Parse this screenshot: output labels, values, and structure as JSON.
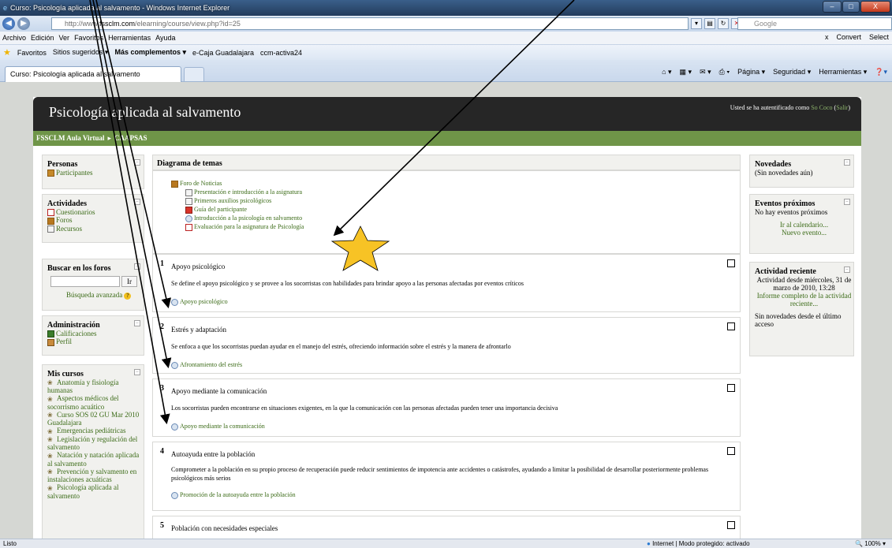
{
  "window": {
    "title": "Curso: Psicología aplicada al salvamento - Windows Internet Explorer",
    "min_label": "–",
    "max_label": "□",
    "close_label": "X"
  },
  "address": {
    "url_prefix": "http://www.",
    "url_domain": "fssclm.com",
    "url_path": "/elearning/course/view.php?id=25",
    "search_placeholder": "Google"
  },
  "menubar": {
    "items": [
      "Archivo",
      "Edición",
      "Ver",
      "Favoritos",
      "Herramientas",
      "Ayuda"
    ],
    "right_close": "x",
    "convert": "Convert",
    "select": "Select"
  },
  "favorites": {
    "label": "Favoritos",
    "items": [
      "Sitios sugeridos ▾",
      "Más complementos ▾",
      "e-Caja Guadalajara",
      "ccm-activa24"
    ]
  },
  "tabs": {
    "active": "Curso: Psicología aplicada al salvamento"
  },
  "commandbar": {
    "items": [
      "Página ▾",
      "Seguridad ▾",
      "Herramientas ▾"
    ]
  },
  "site": {
    "title": "Psicología aplicada al salvamento",
    "login_text": "Usted se ha autentificado como ",
    "user": "So Coco",
    "logout": "Salir"
  },
  "breadcrumb": {
    "home": "FSSCLM Aula Virtual",
    "separator": "▸",
    "course": "CAAPSAS"
  },
  "left": {
    "personas": {
      "title": "Personas",
      "items": [
        "Participantes"
      ]
    },
    "actividades": {
      "title": "Actividades",
      "items": [
        "Cuestionarios",
        "Foros",
        "Recursos"
      ]
    },
    "buscar": {
      "title": "Buscar en los foros",
      "button": "Ir",
      "advanced": "Búsqueda avanzada"
    },
    "admin": {
      "title": "Administración",
      "items": [
        "Calificaciones",
        "Perfil"
      ]
    },
    "cursos": {
      "title": "Mis cursos",
      "items": [
        "Anatomía y fisiología humanas",
        "Aspectos médicos del socorrismo acuático",
        "Curso SOS 02 GU Mar 2010 Guadalajara",
        "Emergencias pediátricas",
        "Legislación y regulación del salvamento",
        "Natación y natación aplicada al salvamento",
        "Prevención y salvamento en instalaciones acuáticas",
        "Psicología aplicada al salvamento"
      ]
    }
  },
  "center": {
    "header": "Diagrama de temas",
    "topic0_items": [
      "Foro de Noticias",
      "Presentación e introducción a la asignatura",
      "Primeros auxilios psicológicos",
      "Guía del participante",
      "Introducción a la psicología en salvamento",
      "Evaluación para la asignatura de Psicología"
    ],
    "sections": [
      {
        "num": "1",
        "name": "Apoyo psicológico",
        "desc": "Se define el apoyo psicológico y se provee a los socorristas con habilidades para brindar apoyo a las personas afectadas por eventos críticos",
        "link": "Apoyo psicológico"
      },
      {
        "num": "2",
        "name": "Estrés y adaptación",
        "desc": "Se enfoca a que los socorristas puedan ayudar en el manejo del estrés, ofreciendo información sobre el estrés y la manera de afrontarlo",
        "link": "Afrontamiento del estrés"
      },
      {
        "num": "3",
        "name": "Apoyo mediante la comunicación",
        "desc": "Los socorristas pueden encontrarse en situaciones exigentes, en la que la comunicación con las personas afectadas pueden tener una importancia decisiva",
        "link": "Apoyo mediante la comunicación"
      },
      {
        "num": "4",
        "name": "Autoayuda entre la población",
        "desc": "Comprometer a la población en su propio proceso de recuperación puede reducir sentimientos de impotencia ante accidentes o catástrofes, ayudando a limitar la posibilidad de desarrollar posteriormente problemas psicológicos más serios",
        "link": "Promoción de la autoayuda entre la población"
      },
      {
        "num": "5",
        "name": "Población con necesidades especiales",
        "desc": "",
        "link": ""
      }
    ]
  },
  "right": {
    "novedades": {
      "title": "Novedades",
      "text": "(Sin novedades aún)"
    },
    "eventos": {
      "title": "Eventos próximos",
      "text": "No hay eventos próximos",
      "calendar": "Ir al calendario...",
      "new_event": "Nuevo evento..."
    },
    "reciente": {
      "title": "Actividad reciente",
      "since": "Actividad desde miércoles, 31 de marzo de 2010, 13:28",
      "report": "Informe completo de la actividad reciente...",
      "none": "Sin novedades desde el último acceso"
    }
  },
  "status": {
    "left": "Listo",
    "zone": "Internet | Modo protegido: activado",
    "zoom": "100%"
  },
  "colors": {
    "header_bg": "#262626",
    "nav_green": "#6f9548",
    "link_green": "#3b6b17",
    "star": "#f7c325"
  }
}
